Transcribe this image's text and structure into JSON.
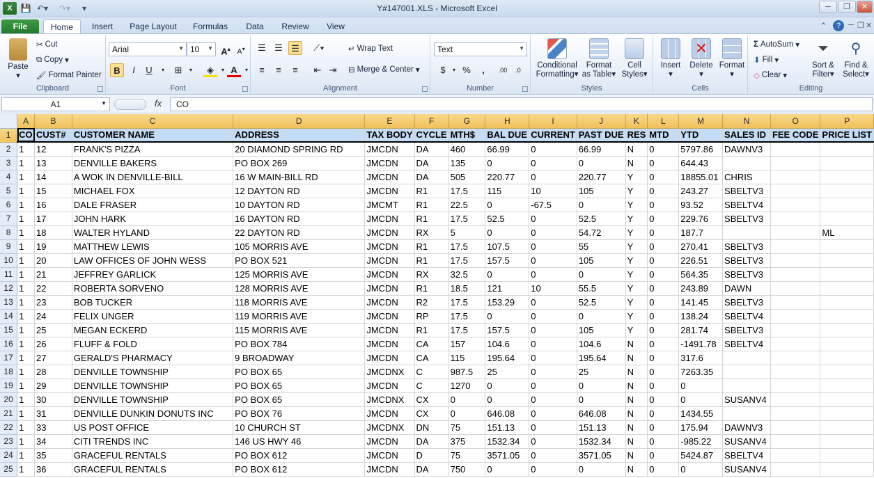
{
  "window": {
    "title": "Y#147001.XLS  -  Microsoft Excel"
  },
  "ribbon_tabs": [
    "File",
    "Home",
    "Insert",
    "Page Layout",
    "Formulas",
    "Data",
    "Review",
    "View"
  ],
  "clipboard": {
    "paste": "Paste",
    "cut": "Cut",
    "copy": "Copy",
    "format_painter": "Format Painter",
    "label": "Clipboard"
  },
  "font": {
    "name": "Arial",
    "size": "10",
    "bold": "B",
    "italic": "I",
    "underline": "U",
    "label": "Font"
  },
  "alignment": {
    "wrap_text": "Wrap Text",
    "merge_center": "Merge & Center",
    "label": "Alignment"
  },
  "number": {
    "format": "Text",
    "currency": "$",
    "percent": "%",
    "comma": ",",
    "label": "Number"
  },
  "styles": {
    "conditional": "Conditional",
    "conditional2": "Formatting",
    "format_as": "Format",
    "format_as2": "as Table",
    "cell": "Cell",
    "cell2": "Styles",
    "label": "Styles"
  },
  "cells": {
    "insert": "Insert",
    "delete": "Delete",
    "format": "Format",
    "label": "Cells"
  },
  "editing": {
    "autosum": "AutoSum",
    "fill": "Fill",
    "clear": "Clear",
    "sort": "Sort &",
    "sort2": "Filter",
    "find": "Find &",
    "find2": "Select",
    "label": "Editing"
  },
  "formula_bar": {
    "name_box": "A1",
    "fx": "fx",
    "content": "CO"
  },
  "columns": [
    "A",
    "B",
    "C",
    "D",
    "E",
    "F",
    "G",
    "H",
    "I",
    "J",
    "K",
    "L",
    "M",
    "N",
    "O",
    "P"
  ],
  "header_row": [
    "CO",
    "CUST#",
    "CUSTOMER NAME",
    "ADDRESS",
    "TAX BODY",
    "CYCLE",
    "MTH$",
    "BAL DUE",
    "CURRENT",
    "PAST DUE",
    "RES",
    "MTD",
    "YTD",
    "SALES ID",
    "FEE CODE",
    "PRICE LIST"
  ],
  "rows": [
    [
      "1",
      "12",
      "FRANK'S PIZZA",
      "20  DIAMOND SPRING RD",
      "JMCDN",
      "DA",
      "460",
      "66.99",
      "0",
      "66.99",
      "N",
      "0",
      "5797.86",
      "DAWNV3",
      "",
      ""
    ],
    [
      "1",
      "13",
      "DENVILLE BAKERS",
      "PO BOX 269",
      "JMCDN",
      "DA",
      "135",
      "0",
      "0",
      "0",
      "N",
      "0",
      "644.43",
      "",
      "",
      ""
    ],
    [
      "1",
      "14",
      "A WOK IN DENVILLE-BILL",
      "16 W MAIN-BILL RD",
      "JMCDN",
      "DA",
      "505",
      "220.77",
      "0",
      "220.77",
      "Y",
      "0",
      "18855.01",
      "CHRIS",
      "",
      ""
    ],
    [
      "1",
      "15",
      "MICHAEL FOX",
      "12  DAYTON RD",
      "JMCDN",
      "R1",
      "17.5",
      "115",
      "10",
      "105",
      "Y",
      "0",
      "243.27",
      "SBELTV3",
      "",
      ""
    ],
    [
      "1",
      "16",
      "DALE FRASER",
      "10  DAYTON RD",
      "JMCMT",
      "R1",
      "22.5",
      "0",
      "-67.5",
      "0",
      "Y",
      "0",
      "93.52",
      "SBELTV4",
      "",
      ""
    ],
    [
      "1",
      "17",
      "JOHN HARK",
      "16  DAYTON RD",
      "JMCDN",
      "R1",
      "17.5",
      "52.5",
      "0",
      "52.5",
      "Y",
      "0",
      "229.76",
      "SBELTV3",
      "",
      ""
    ],
    [
      "1",
      "18",
      "WALTER HYLAND",
      "22  DAYTON RD",
      "JMCDN",
      "RX",
      "5",
      "0",
      "0",
      "54.72",
      "Y",
      "0",
      "187.7",
      "",
      "",
      "ML"
    ],
    [
      "1",
      "19",
      "MATTHEW LEWIS",
      "105  MORRIS AVE",
      "JMCDN",
      "R1",
      "17.5",
      "107.5",
      "0",
      "55",
      "Y",
      "0",
      "270.41",
      "SBELTV3",
      "",
      ""
    ],
    [
      "1",
      "20",
      "LAW OFFICES OF JOHN WESS",
      "PO BOX 521",
      "JMCDN",
      "R1",
      "17.5",
      "157.5",
      "0",
      "105",
      "Y",
      "0",
      "226.51",
      "SBELTV3",
      "",
      ""
    ],
    [
      "1",
      "21",
      "JEFFREY GARLICK",
      "125  MORRIS AVE",
      "JMCDN",
      "RX",
      "32.5",
      "0",
      "0",
      "0",
      "Y",
      "0",
      "564.35",
      "SBELTV3",
      "",
      ""
    ],
    [
      "1",
      "22",
      "ROBERTA SORVENO",
      "128  MORRIS AVE",
      "JMCDN",
      "R1",
      "18.5",
      "121",
      "10",
      "55.5",
      "Y",
      "0",
      "243.89",
      "DAWN",
      "",
      ""
    ],
    [
      "1",
      "23",
      "BOB TUCKER",
      "118  MORRIS AVE",
      "JMCDN",
      "R2",
      "17.5",
      "153.29",
      "0",
      "52.5",
      "Y",
      "0",
      "141.45",
      "SBELTV3",
      "",
      ""
    ],
    [
      "1",
      "24",
      "FELIX UNGER",
      "119  MORRIS AVE",
      "JMCDN",
      "RP",
      "17.5",
      "0",
      "0",
      "0",
      "Y",
      "0",
      "138.24",
      "SBELTV4",
      "",
      ""
    ],
    [
      "1",
      "25",
      "MEGAN ECKERD",
      "115  MORRIS AVE",
      "JMCDN",
      "R1",
      "17.5",
      "157.5",
      "0",
      "105",
      "Y",
      "0",
      "281.74",
      "SBELTV3",
      "",
      ""
    ],
    [
      "1",
      "26",
      "FLUFF & FOLD",
      "PO BOX 784",
      "JMCDN",
      "CA",
      "157",
      "104.6",
      "0",
      "104.6",
      "N",
      "0",
      "-1491.78",
      "SBELTV4",
      "",
      ""
    ],
    [
      "1",
      "27",
      "GERALD'S PHARMACY",
      "9  BROADWAY",
      "JMCDN",
      "CA",
      "115",
      "195.64",
      "0",
      "195.64",
      "N",
      "0",
      "317.6",
      "",
      "",
      ""
    ],
    [
      "1",
      "28",
      "DENVILLE TOWNSHIP",
      "PO BOX 65",
      "JMCDNX",
      "C",
      "987.5",
      "25",
      "0",
      "25",
      "N",
      "0",
      "7263.35",
      "",
      "",
      ""
    ],
    [
      "1",
      "29",
      "DENVILLE TOWNSHIP",
      "PO BOX 65",
      "JMCDN",
      "C",
      "1270",
      "0",
      "0",
      "0",
      "N",
      "0",
      "0",
      "",
      "",
      ""
    ],
    [
      "1",
      "30",
      "DENVILLE TOWNSHIP",
      "PO BOX 65",
      "JMCDNX",
      "CX",
      "0",
      "0",
      "0",
      "0",
      "N",
      "0",
      "0",
      "SUSANV4",
      "",
      ""
    ],
    [
      "1",
      "31",
      "DENVILLE DUNKIN DONUTS  INC",
      "PO BOX 76",
      "JMCDN",
      "CX",
      "0",
      "646.08",
      "0",
      "646.08",
      "N",
      "0",
      "1434.55",
      "",
      "",
      ""
    ],
    [
      "1",
      "33",
      "US POST OFFICE",
      "10  CHURCH ST",
      "JMCDNX",
      "DN",
      "75",
      "151.13",
      "0",
      "151.13",
      "N",
      "0",
      "175.94",
      "DAWNV3",
      "",
      ""
    ],
    [
      "1",
      "34",
      "CITI TRENDS INC",
      "146  US HWY 46",
      "JMCDN",
      "DA",
      "375",
      "1532.34",
      "0",
      "1532.34",
      "N",
      "0",
      "-985.22",
      "SUSANV4",
      "",
      ""
    ],
    [
      "1",
      "35",
      "GRACEFUL RENTALS",
      "PO BOX 612",
      "JMCDN",
      "D",
      "75",
      "3571.05",
      "0",
      "3571.05",
      "N",
      "0",
      "5424.87",
      "SBELTV4",
      "",
      ""
    ],
    [
      "1",
      "36",
      "GRACEFUL RENTALS",
      "PO BOX 612",
      "JMCDN",
      "DA",
      "750",
      "0",
      "0",
      "0",
      "N",
      "0",
      "0",
      "SUSANV4",
      "",
      ""
    ]
  ]
}
